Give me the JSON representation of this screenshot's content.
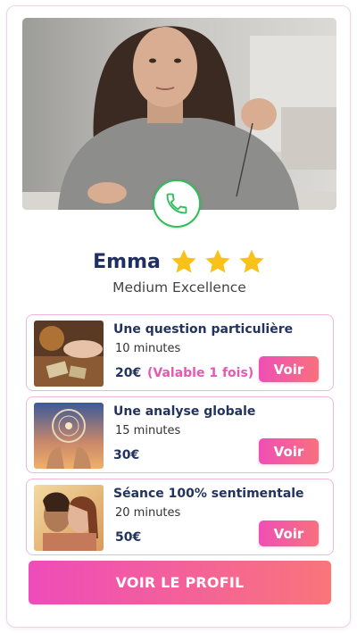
{
  "advisor": {
    "name": "Emma",
    "title": "Medium Excellence",
    "rating_stars": 3
  },
  "call_button": {
    "icon": "phone-icon",
    "color": "#2fbf5a"
  },
  "offers": [
    {
      "title": "Une question particulière",
      "duration": "10 minutes",
      "price": "20€",
      "note": "(Valable 1 fois)",
      "button": "Voir",
      "thumb_icon": "tarot-hand-image"
    },
    {
      "title": "Une analyse globale",
      "duration": "15 minutes",
      "price": "30€",
      "note": "",
      "button": "Voir",
      "thumb_icon": "zodiac-hands-image"
    },
    {
      "title": "Séance 100% sentimentale",
      "duration": "20 minutes",
      "price": "50€",
      "note": "",
      "button": "Voir",
      "thumb_icon": "couple-image"
    }
  ],
  "profile_button": "VOIR LE PROFIL",
  "colors": {
    "accent_gradient_start": "#ef4fb5",
    "accent_gradient_end": "#f8707e",
    "name_color": "#1f2f62",
    "star_color": "#f9c21a",
    "note_color": "#e459b4"
  }
}
